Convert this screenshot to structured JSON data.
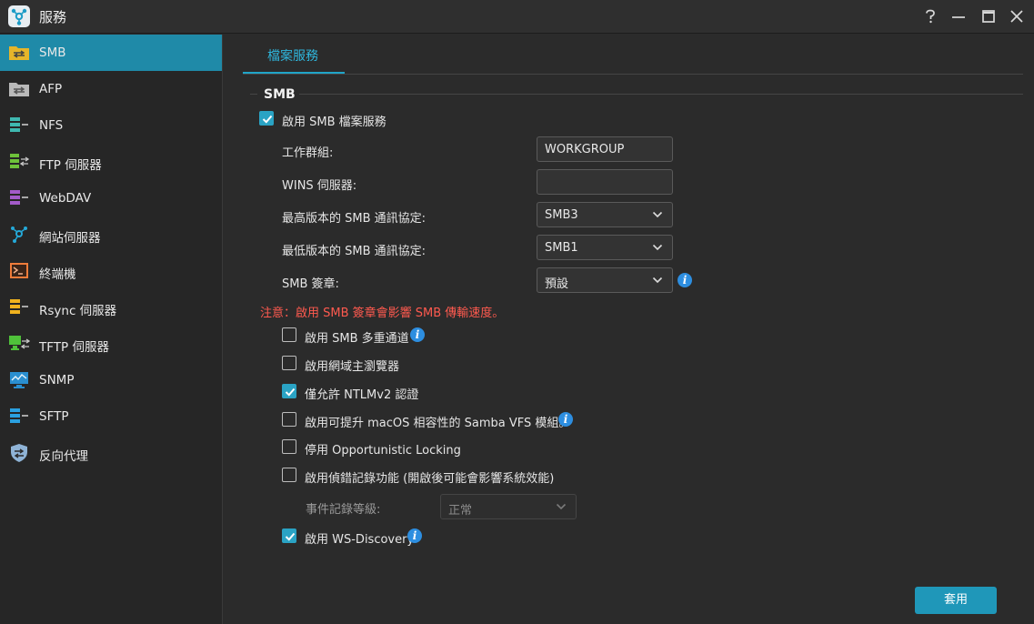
{
  "window": {
    "title": "服務"
  },
  "sidebar": {
    "items": [
      {
        "label": "SMB"
      },
      {
        "label": "AFP"
      },
      {
        "label": "NFS"
      },
      {
        "label": "FTP 伺服器"
      },
      {
        "label": "WebDAV"
      },
      {
        "label": "網站伺服器"
      },
      {
        "label": "終端機"
      },
      {
        "label": "Rsync 伺服器"
      },
      {
        "label": "TFTP 伺服器"
      },
      {
        "label": "SNMP"
      },
      {
        "label": "SFTP"
      },
      {
        "label": "反向代理"
      }
    ]
  },
  "tabs": [
    {
      "label": "檔案服務"
    }
  ],
  "smb": {
    "section_title": "SMB",
    "enable_label": "啟用 SMB 檔案服務",
    "workgroup_label": "工作群組:",
    "workgroup_value": "WORKGROUP",
    "wins_label": "WINS 伺服器:",
    "wins_value": "",
    "max_proto_label": "最高版本的 SMB 通訊協定:",
    "max_proto_value": "SMB3",
    "min_proto_label": "最低版本的 SMB 通訊協定:",
    "min_proto_value": "SMB1",
    "signing_label": "SMB 簽章:",
    "signing_value": "預設",
    "warning": "注意：啟用 SMB 簽章會影響 SMB 傳輸速度。",
    "options": {
      "multichannel": "啟用 SMB 多重通道",
      "domain_master": "啟用網域主瀏覽器",
      "ntlmv2": "僅允許 NTLMv2 認證",
      "vfs": "啟用可提升 macOS 相容性的 Samba VFS 模組。",
      "oplocks": "停用 Opportunistic Locking",
      "debug_log": "啟用偵錯記錄功能 (開啟後可能會影響系統效能)",
      "wsd": "啟用 WS-Discovery"
    },
    "log_level_label": "事件記錄等級:",
    "log_level_value": "正常"
  },
  "apply_label": "套用",
  "colors": {
    "accent": "#1f8aa8",
    "warning": "#ff5a4f",
    "info": "#2d8ee0"
  }
}
